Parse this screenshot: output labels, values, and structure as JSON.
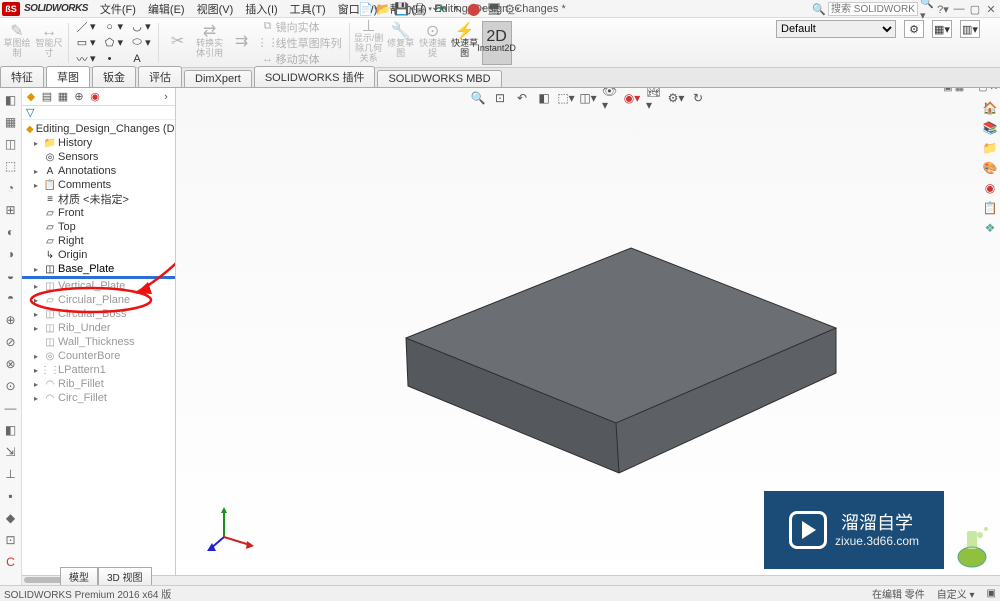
{
  "brand": "SOLIDWORKS",
  "menus": {
    "file": "文件(F)",
    "edit": "编辑(E)",
    "view": "视图(V)",
    "insert": "插入(I)",
    "tools": "工具(T)",
    "window": "窗口(W)",
    "help": "帮助(H)"
  },
  "doc_title": "Editing_Design_Changes *",
  "search_placeholder": "搜索 SOLIDWORKS 帮助",
  "ribbon": {
    "sketch": "草图绘\n制",
    "smart_dim": "智能尺\n寸",
    "convert": "转换实\n体引用",
    "mirror": "镜向实体",
    "linear_pattern": "线性草图阵列",
    "move_entities": "移动实体",
    "show_rel": "显示/删除几何关系",
    "repair": "修复草图",
    "quick_snap": "快速捕捉",
    "rapid_sketch": "快速草图",
    "instant2d": "Instant2D"
  },
  "tabs": {
    "features": "特征",
    "sketch": "草图",
    "sheetmetal": "钣金",
    "evaluate": "评估",
    "dimxpert": "DimXpert",
    "sw_addins": "SOLIDWORKS 插件",
    "sw_mbd": "SOLIDWORKS MBD"
  },
  "config": {
    "default": "Default"
  },
  "tree": {
    "root": "Editing_Design_Changes  (Default<<D",
    "history": "History",
    "sensors": "Sensors",
    "annotations": "Annotations",
    "comments": "Comments",
    "material": "材质 <未指定>",
    "front": "Front",
    "top": "Top",
    "right": "Right",
    "origin": "Origin",
    "base_plate": "Base_Plate",
    "vertical_plate": "Vertical_Plate",
    "circular_plane": "Circular_Plane",
    "circular_boss": "Circular_Boss",
    "rib_under": "Rib_Under",
    "wall_thickness": "Wall_Thickness",
    "counterbore": "CounterBore",
    "lpattern1": "LPattern1",
    "rib_fillet": "Rib_Fillet",
    "circ_fillet": "Circ_Fillet"
  },
  "bottom_tabs": {
    "model": "模型",
    "view3d": "3D 视图"
  },
  "status": {
    "version": "SOLIDWORKS Premium 2016 x64 版",
    "editing": "在编辑 零件",
    "custom": "自定义 ▾"
  },
  "watermark": {
    "line1": "溜溜自学",
    "line2": "zixue.3d66.com"
  }
}
